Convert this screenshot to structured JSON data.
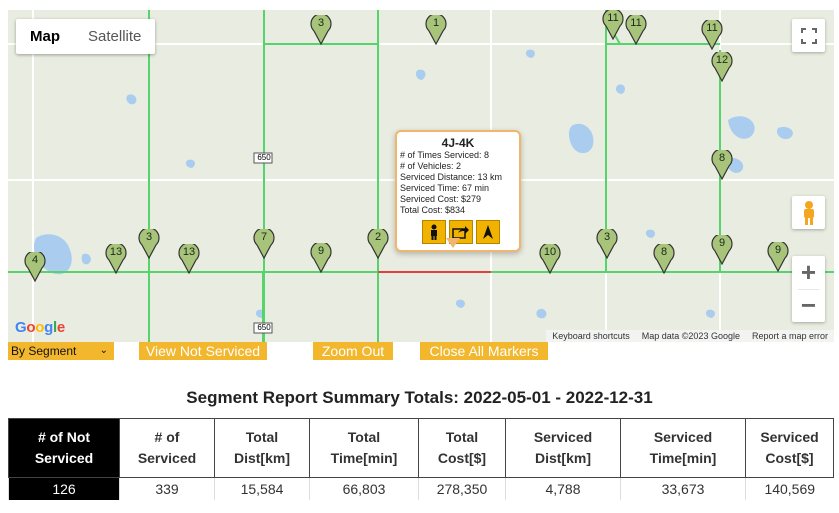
{
  "map": {
    "type_buttons": [
      "Map",
      "Satellite"
    ],
    "active_type": "Map",
    "road_labels": [
      "650",
      "650"
    ],
    "google_logo": "Google",
    "attribution": [
      "Keyboard shortcuts",
      "Map data ©2023 Google",
      "Report a map error"
    ],
    "zoom_in": "+",
    "zoom_out": "−",
    "markers": [
      "3",
      "1",
      "11",
      "11",
      "11",
      "12",
      "8",
      "9",
      "9",
      "13",
      "13",
      "3",
      "7",
      "9",
      "2",
      "10",
      "3",
      "8",
      "4"
    ]
  },
  "infowindow": {
    "title": "4J-4K",
    "lines": [
      "# of Times Serviced: 8",
      "# of Vehicles: 2",
      "Serviced Distance: 13 km",
      "Serviced Time: 67 min",
      "Serviced Cost: $279",
      "Total Cost: $834"
    ]
  },
  "toolbar": {
    "select_value": "By Segment",
    "view_not_serviced": "View Not Serviced",
    "zoom_out": "Zoom Out",
    "close_all_markers": "Close All Markers"
  },
  "summary": {
    "title": "Segment Report Summary Totals: 2022-05-01 - 2022-12-31",
    "headers": [
      [
        "# of Not",
        "Serviced"
      ],
      [
        "# of",
        "Serviced"
      ],
      [
        "Total",
        "Dist[km]"
      ],
      [
        "Total",
        "Time[min]"
      ],
      [
        "Total",
        "Cost[$]"
      ],
      [
        "Serviced",
        "Dist[km]"
      ],
      [
        "Serviced",
        "Time[min]"
      ],
      [
        "Serviced",
        "Cost[$]"
      ]
    ],
    "values": [
      "126",
      "339",
      "15,584",
      "66,803",
      "278,350",
      "4,788",
      "33,673",
      "140,569"
    ]
  },
  "colors": {
    "accent": "#f2b72d",
    "road": "#56d36a",
    "highlight": "#e04040",
    "marker": "#a7c47a"
  }
}
